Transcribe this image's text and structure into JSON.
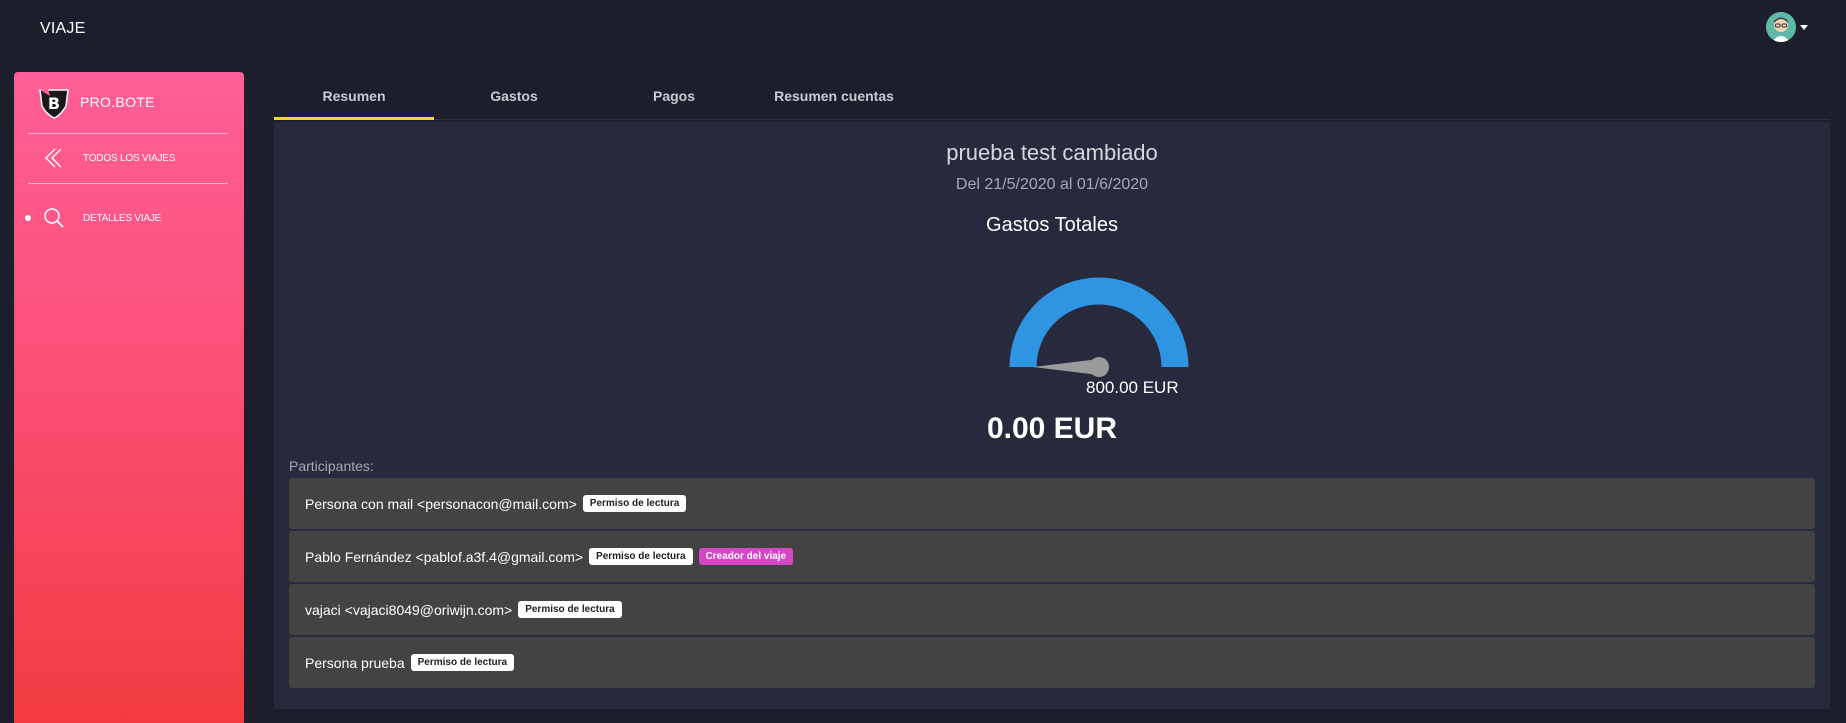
{
  "app": {
    "title": "VIAJE"
  },
  "user": {
    "avatar_icon": "user-avatar-icon"
  },
  "sidebar": {
    "brand": "PRO.BOTE",
    "items": [
      {
        "label": "TODOS LOS VIAJES",
        "icon": "chevrons-left-icon"
      },
      {
        "label": "DETALLES VIAJE",
        "icon": "search-icon"
      }
    ],
    "gradient": [
      "#ff5f98",
      "#f33a3f"
    ]
  },
  "tabs": [
    {
      "label": "Resumen",
      "active": true
    },
    {
      "label": "Gastos"
    },
    {
      "label": "Pagos"
    },
    {
      "label": "Resumen cuentas"
    }
  ],
  "trip": {
    "name": "prueba test cambiado",
    "dates": "Del 21/5/2020 al 01/6/2020"
  },
  "gauge": {
    "title": "Gastos Totales",
    "max_label": "800.00 EUR",
    "value_label": "0.00 EUR",
    "value": 0,
    "max": 800,
    "color": "#2f95e3"
  },
  "participants": {
    "label": "Participantes:",
    "rows": [
      {
        "name": "Persona con mail <personacon@mail.com>",
        "badges": [
          "Permiso de lectura"
        ]
      },
      {
        "name": "Pablo Fernández <pablof.a3f.4@gmail.com>",
        "badges": [
          "Permiso de lectura",
          "Creador del viaje"
        ]
      },
      {
        "name": "vajaci <vajaci8049@oriwijn.com>",
        "badges": [
          "Permiso de lectura"
        ]
      },
      {
        "name": "Persona prueba",
        "badges": [
          "Permiso de lectura"
        ]
      }
    ]
  }
}
